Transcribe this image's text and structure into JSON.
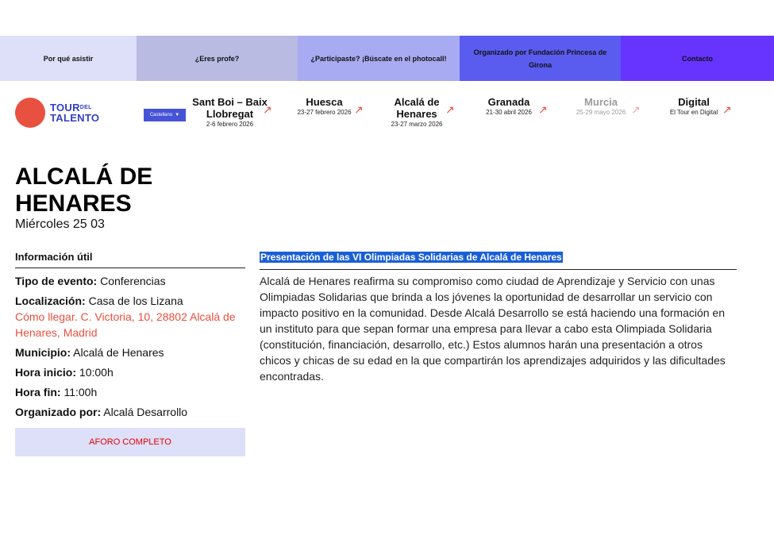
{
  "top_nav": [
    {
      "label": "Por qué asistir"
    },
    {
      "label": "¿Eres profe?"
    },
    {
      "label": "¿Participaste? ¡Búscate en el photocall!"
    },
    {
      "label": "Organizado por Fundación Princesa de Girona"
    },
    {
      "label": "Contacto"
    }
  ],
  "logo": {
    "line1": "TOUR",
    "del": "DEL",
    "line2": "TALENTO"
  },
  "language": {
    "selected": "Castellano",
    "caret": "▼"
  },
  "cities": [
    {
      "name": "Sant Boi – Baix Llobregat",
      "date": "2-6 febrero 2026"
    },
    {
      "name": "Huesca",
      "date": "23-27 febrero 2026"
    },
    {
      "name": "Alcalá de Henares",
      "date": "23-27 marzo 2026"
    },
    {
      "name": "Granada",
      "date": "21-30 abril 2026"
    },
    {
      "name": "Murcia",
      "date": "25-29 mayo 2026"
    },
    {
      "name": "Digital",
      "date": "El Tour en Digital"
    }
  ],
  "page": {
    "title": "ALCALÁ DE HENARES",
    "date": "Miércoles 25 03"
  },
  "info": {
    "heading": "Información útil",
    "tipo_label": "Tipo de evento:",
    "tipo_value": "Conferencias",
    "loc_label": "Localización:",
    "loc_value": "Casa de los Lizana",
    "loc_link": "Cómo llegar. C. Victoria, 10, 28802 Alcalá de Henares, Madrid",
    "mun_label": "Municipio:",
    "mun_value": "Alcalá de Henares",
    "inicio_label": "Hora inicio:",
    "inicio_value": "10:00h",
    "fin_label": "Hora fin:",
    "fin_value": "11:00h",
    "org_label": "Organizado por:",
    "org_value": "Alcalá Desarrollo"
  },
  "aforo": "AFORO COMPLETO",
  "event": {
    "heading": "Presentación de las VI Olimpiadas Solidarias de Alcalá de Henares",
    "body": "Alcalá de Henares reafirma su compromiso como ciudad de Aprendizaje y Servicio con unas Olimpiadas Solidarias que brinda a los jóvenes la oportunidad de desarrollar un servicio con impacto positivo en la comunidad. Desde Alcalá Desarrollo se está haciendo una formación en un instituto para que sepan formar una empresa para llevar a cabo esta Olimpiada Solidaria (constitución, financiación, desarrollo, etc.) Estos alumnos harán una presentación a otros chicos y chicas de su edad en la que compartirán los aprendizajes adquiridos y las dificultades encontradas."
  },
  "colors": {
    "accent": "#e8503f",
    "brand_blue": "#3340c7",
    "highlight": "#1a5fd6",
    "aforo_text": "#e00000"
  }
}
